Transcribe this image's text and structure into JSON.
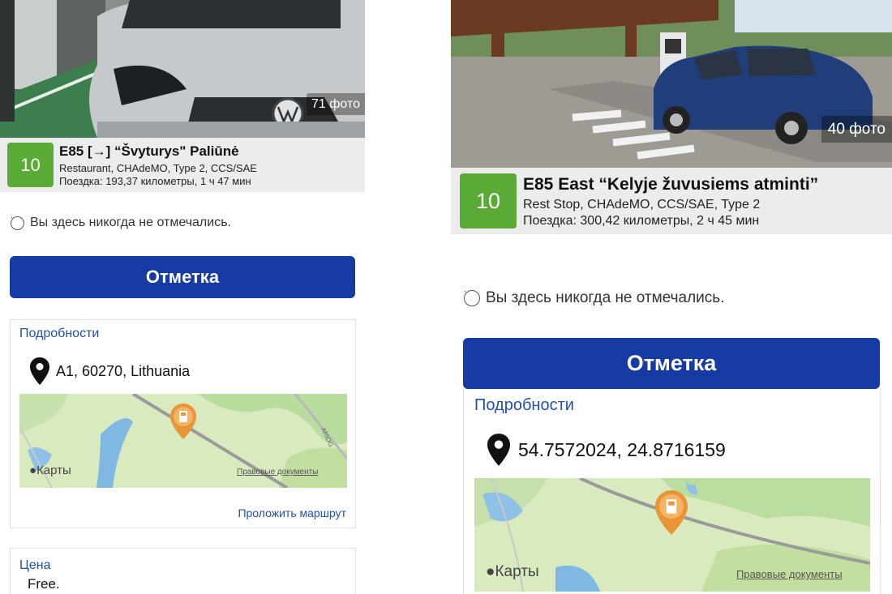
{
  "left": {
    "photo_count": "71 фото",
    "score": "10",
    "name": "E85 [→] “Švyturys\" Paliūnė",
    "amenities": "Restaurant, CHAdeMO, Type 2, CCS/SAE",
    "trip": "Поездка: 193,37 километры, 1 ч 47 мин",
    "checkin_note": "Вы здесь никогда не отмечались.",
    "checkin_button": "Отметка",
    "details_title": "Подробности",
    "address": "A1, 60270, Lithuania",
    "map_brand": "Карты",
    "map_legal": "Правовые документы",
    "map_road_label": "ARIOG",
    "route_link": "Проложить маршрут",
    "price_title": "Цена",
    "price_value": "Free."
  },
  "right": {
    "photo_count": "40 фото",
    "score": "10",
    "name": "E85 East “Kelyje žuvusiems atminti”",
    "amenities": "Rest Stop, CHAdeMO, CCS/SAE, Type 2",
    "trip": "Поездка: 300,42 километры, 2 ч 45 мин",
    "checkin_note": "Вы здесь никогда не отмечались.",
    "checkin_button": "Отметка",
    "details_title": "Подробности",
    "address": "54.7572024, 24.8716159",
    "map_brand": "Карты",
    "map_legal": "Правовые документы"
  },
  "colors": {
    "accent_button": "#173ba5",
    "score_badge": "#5aab35",
    "link": "#1f4fb0",
    "map_pin": "#e8953a"
  }
}
